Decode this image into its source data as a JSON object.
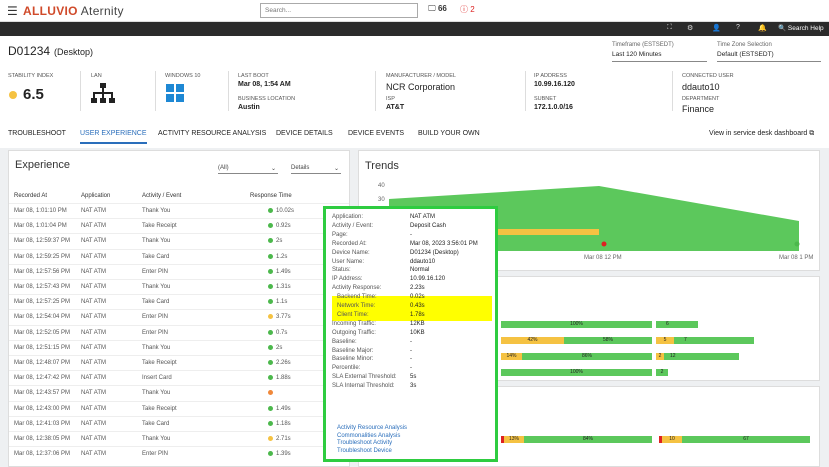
{
  "app": {
    "brand_a": "ALLUVIO",
    "brand_b": "Aternity"
  },
  "topbar": {
    "search_placeholder": "Search...",
    "monitor_count": "66",
    "alert_count": "2",
    "help": "Search Help"
  },
  "header": {
    "device": "D01234",
    "device_type": "(Desktop)",
    "timeframe_label": "Timeframe (ESTSEDT)",
    "timeframe_value": "Last 120 Minutes",
    "tz_label": "Time Zone Selection",
    "tz_value": "Default (ESTSEDT)",
    "stability_label": "STABILITY INDEX",
    "stability_value": "6.5",
    "lan_label": "LAN",
    "os_label": "WINDOWS 10",
    "last_boot_label": "LAST BOOT",
    "last_boot_value": "Mar 08, 1:54 AM",
    "location_label": "BUSINESS LOCATION",
    "location_value": "Austin",
    "manufacturer_label": "MANUFACTURER / MODEL",
    "manufacturer_value": "NCR Corporation",
    "isp_label": "ISP",
    "isp_value": "AT&T",
    "ip_label": "IP ADDRESS",
    "ip_value": "10.99.16.120",
    "subnet_label": "SUBNET",
    "subnet_value": "172.1.0.0/16",
    "user_label": "CONNECTED USER",
    "user_value": "ddauto10",
    "dept_label": "DEPARTMENT",
    "dept_value": "Finance"
  },
  "tabs": [
    "TROUBLESHOOT",
    "USER EXPERIENCE",
    "ACTIVITY RESOURCE ANALYSIS",
    "DEVICE DETAILS",
    "DEVICE EVENTS",
    "BUILD YOUR OWN"
  ],
  "view_link": "View in service desk dashboard",
  "experience": {
    "title": "Experience",
    "filter": "(All)",
    "details": "Details",
    "headers": [
      "Recorded At",
      "Application",
      "Activity / Event",
      "Response Time"
    ],
    "rows": [
      {
        "t": "Mar 08, 1:01:10 PM",
        "app": "NAT ATM",
        "act": "Thank You",
        "rt": "10.02s",
        "c": "#4cb84c"
      },
      {
        "t": "Mar 08, 1:01:04 PM",
        "app": "NAT ATM",
        "act": "Take Receipt",
        "rt": "0.92s",
        "c": "#4cb84c"
      },
      {
        "t": "Mar 08, 12:59:37 PM",
        "app": "NAT ATM",
        "act": "Thank You",
        "rt": "2s",
        "c": "#4cb84c"
      },
      {
        "t": "Mar 08, 12:59:25 PM",
        "app": "NAT ATM",
        "act": "Take Card",
        "rt": "1.2s",
        "c": "#4cb84c"
      },
      {
        "t": "Mar 08, 12:57:56 PM",
        "app": "NAT ATM",
        "act": "Enter PIN",
        "rt": "1.49s",
        "c": "#4cb84c"
      },
      {
        "t": "Mar 08, 12:57:43 PM",
        "app": "NAT ATM",
        "act": "Thank You",
        "rt": "1.31s",
        "c": "#4cb84c"
      },
      {
        "t": "Mar 08, 12:57:25 PM",
        "app": "NAT ATM",
        "act": "Take Card",
        "rt": "1.1s",
        "c": "#4cb84c"
      },
      {
        "t": "Mar 08, 12:54:04 PM",
        "app": "NAT ATM",
        "act": "Enter PIN",
        "rt": "3.77s",
        "c": "#f5c242"
      },
      {
        "t": "Mar 08, 12:52:05 PM",
        "app": "NAT ATM",
        "act": "Enter PIN",
        "rt": "0.7s",
        "c": "#4cb84c"
      },
      {
        "t": "Mar 08, 12:51:15 PM",
        "app": "NAT ATM",
        "act": "Thank You",
        "rt": "2s",
        "c": "#4cb84c"
      },
      {
        "t": "Mar 08, 12:48:07 PM",
        "app": "NAT ATM",
        "act": "Take Receipt",
        "rt": "2.26s",
        "c": "#4cb84c"
      },
      {
        "t": "Mar 08, 12:47:42 PM",
        "app": "NAT ATM",
        "act": "Insert Card",
        "rt": "1.88s",
        "c": "#4cb84c"
      },
      {
        "t": "Mar 08, 12:43:57 PM",
        "app": "NAT ATM",
        "act": "Thank You",
        "rt": "",
        "c": "#f0883a"
      },
      {
        "t": "Mar 08, 12:43:00 PM",
        "app": "NAT ATM",
        "act": "Take Receipt",
        "rt": "1.49s",
        "c": "#4cb84c"
      },
      {
        "t": "Mar 08, 12:41:03 PM",
        "app": "NAT ATM",
        "act": "Take Card",
        "rt": "1.18s",
        "c": "#4cb84c"
      },
      {
        "t": "Mar 08, 12:38:05 PM",
        "app": "NAT ATM",
        "act": "Thank You",
        "rt": "2.71s",
        "c": "#f5c242"
      },
      {
        "t": "Mar 08, 12:37:06 PM",
        "app": "NAT ATM",
        "act": "Enter PIN",
        "rt": "1.39s",
        "c": "#4cb84c"
      }
    ]
  },
  "trends": {
    "title": "Trends",
    "y_ticks": [
      "40",
      "30"
    ],
    "x_ticks": [
      "Mar 08 12 PM",
      "Mar 08 1 PM"
    ],
    "bars": [
      {
        "label": "100%",
        "v": "6"
      },
      {
        "label": "42%",
        "label2": "58%",
        "v": "5",
        "v2": "7"
      },
      {
        "label": "14%",
        "label2": "86%",
        "v": "2",
        "v2": "12"
      },
      {
        "label": "100%",
        "v": "2"
      }
    ],
    "bottom": [
      {
        "a": "13%",
        "b": "84%"
      },
      {
        "a": "10",
        "b": "67"
      }
    ]
  },
  "tooltip": {
    "rows": [
      {
        "l": "Application:",
        "v": "NAT ATM"
      },
      {
        "l": "Activity / Event:",
        "v": "Deposit Cash"
      },
      {
        "l": "Page:",
        "v": "-"
      },
      {
        "l": "Recorded At:",
        "v": "Mar 08, 2023 3:56:01 PM"
      },
      {
        "l": "Device Name:",
        "v": "D01234 (Desktop)"
      },
      {
        "l": "User Name:",
        "v": "ddauto10"
      },
      {
        "l": "Status:",
        "v": "Normal"
      },
      {
        "l": "IP Address:",
        "v": "10.99.16.120"
      },
      {
        "l": "Activity Response:",
        "v": "2.23s"
      },
      {
        "l": "Backend Time:",
        "v": "0.02s"
      },
      {
        "l": "Network Time:",
        "v": "0.43s"
      },
      {
        "l": "Client Time:",
        "v": "1.78s"
      },
      {
        "l": "Incoming Traffic:",
        "v": "12KB"
      },
      {
        "l": "Outgoing Traffic:",
        "v": "10KB"
      },
      {
        "l": "Baseline:",
        "v": "-"
      },
      {
        "l": "Baseline Major:",
        "v": "-"
      },
      {
        "l": "Baseline Minor:",
        "v": "-"
      },
      {
        "l": "Percentile:",
        "v": "-"
      },
      {
        "l": "SLA External Threshold:",
        "v": "5s"
      },
      {
        "l": "SLA Internal Threshold:",
        "v": "3s"
      }
    ],
    "links": [
      "Activity Resource Analysis",
      "Commonalities Analysis",
      "Troubleshoot Activity",
      "Troubleshoot Device"
    ]
  }
}
